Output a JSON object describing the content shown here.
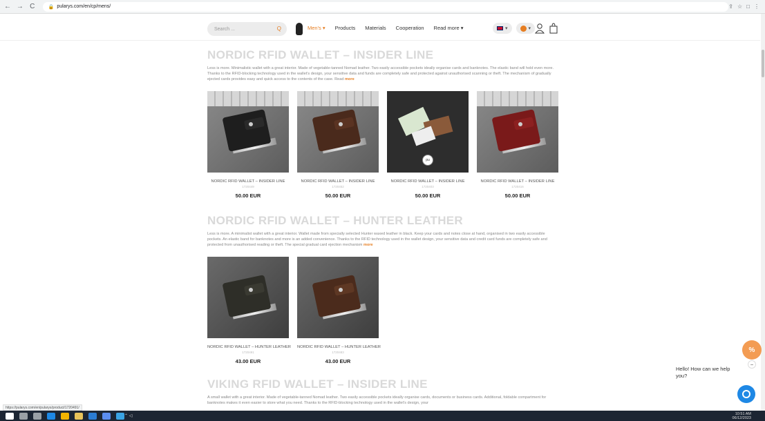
{
  "browser": {
    "url": "pularys.com/en/cp/mens/",
    "back": "←",
    "forward": "→",
    "reload": "C",
    "actions": [
      "⇪",
      "☆",
      "□",
      "⋮"
    ]
  },
  "header": {
    "search_placeholder": "Search ...",
    "search_icon": "Q",
    "nav": [
      {
        "label": "Men's ▾",
        "active": true
      },
      {
        "label": "Products",
        "active": false
      },
      {
        "label": "Materials",
        "active": false
      },
      {
        "label": "Cooperation",
        "active": false
      },
      {
        "label": "Read more ▾",
        "active": false
      }
    ],
    "lang_caret": "▾",
    "currency_caret": "▾"
  },
  "sections": [
    {
      "title": "NORDIC RFID WALLET – INSIDER LINE",
      "description": "Less is more. Minimalistic wallet with a great interior. Made of vegetable-tanned Nomad leather. Two easily accessible pockets ideally organise cards and banknotes. The elastic band will hold even more. Thanks to the RFID-blocking technology used in the wallet's design, your sensitive data and funds are completely safe and protected against unauthorised scanning or theft. The mechanism of gradually ejected cards provides easy and quick access to the contents of the case. Read",
      "more": "more",
      "products": [
        {
          "name": "NORDIC RFID WALLET – INSIDER LINE",
          "code": "1720449",
          "price": "50.00 EUR"
        },
        {
          "name": "NORDIC RFID WALLET – INSIDER LINE",
          "code": "1720452",
          "price": "50.00 EUR"
        },
        {
          "name": "NORDIC RFID WALLET – INSIDER LINE",
          "code": "1720403",
          "price": "50.00 EUR"
        },
        {
          "name": "NORDIC RFID WALLET – INSIDER LINE",
          "code": "1720416",
          "price": "50.00 EUR"
        }
      ]
    },
    {
      "title": "NORDIC RFID WALLET – HUNTER LEATHER",
      "description": "Less is more. A minimalist wallet with a great interior. Wallet made from specially selected Hunter waxed leather in black. Keep your cards and notes close at hand, organised in two easily accessible pockets. An elastic band for banknotes and more is an added convenience. Thanks to the RFID technology used in the wallet design, your sensitive data and credit card funds are completely safe and protected from unauthorised reading or theft. The special gradual card ejection mechanism",
      "more": "more",
      "products": [
        {
          "name": "NORDIC RFID WALLET – HUNTER LEATHER",
          "code": "1720491",
          "price": "43.00 EUR"
        },
        {
          "name": "NORDIC RFID WALLET – HUNTER LEATHER",
          "code": "1720483",
          "price": "43.00 EUR"
        }
      ]
    },
    {
      "title": "VIKING RFID WALLET – INSIDER LINE",
      "description": "A small wallet with a great interior. Made of vegetable-tanned Nomad leather. Two easily accessible pockets ideally organise cards, documents or business cards. Additional, foldable compartment for banknotes makes it even easier to store what you need. Thanks to the RFID-blocking technology used in the wallet's design, your"
    }
  ],
  "chat": {
    "percent_icon": "%",
    "minimize": "−",
    "message": "Hello! How can we help you?"
  },
  "status_url": "https://pularys.com/en/pularys/product/1720491/",
  "taskbar": {
    "time": "10:51 AM",
    "date": "06/12/2023",
    "tray": "⌃ ◁"
  }
}
